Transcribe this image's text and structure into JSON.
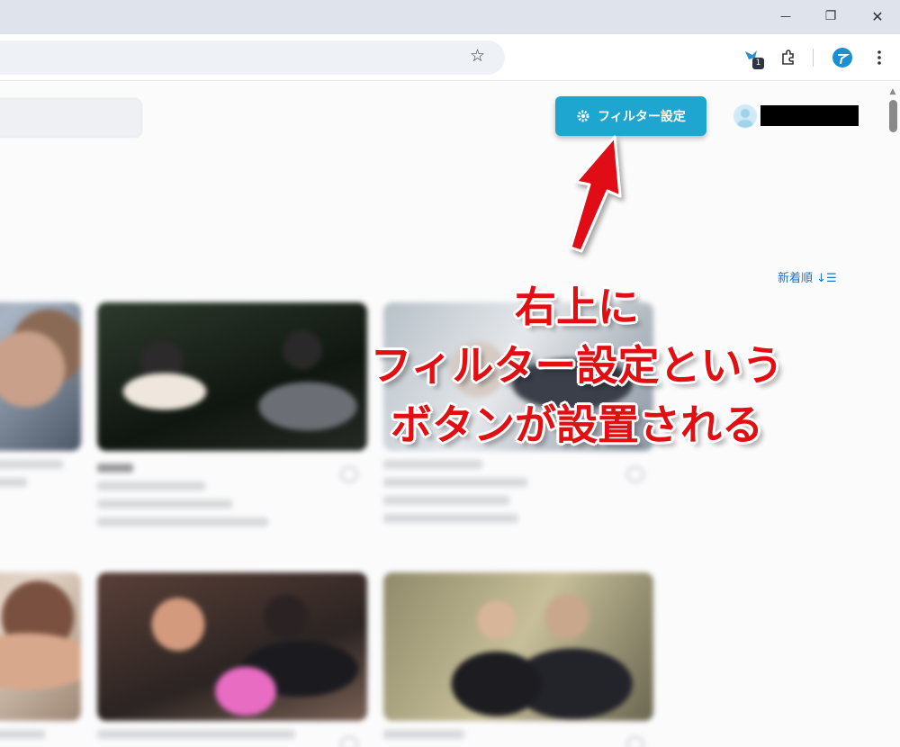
{
  "browser": {
    "window_controls": {
      "minimize": "—",
      "restore": "❐",
      "close": "✕"
    },
    "extension_badge": "1",
    "icons": [
      "bookmark-star-icon",
      "extension-bird-icon",
      "puzzle-icon",
      "profile-icon",
      "menu-kebab-icon"
    ]
  },
  "page": {
    "filter_button_label": "フィルター設定",
    "sort_label": "新着順",
    "sort_icon": "sort-descending-icon",
    "filter_icon": "gear-icon",
    "accent_color": "#1ea6d1",
    "link_color": "#1f74c9"
  },
  "annotation": {
    "lines": [
      "右上に",
      "フィルター設定という",
      "ボタンが設置される"
    ],
    "color": "#e10f12"
  }
}
